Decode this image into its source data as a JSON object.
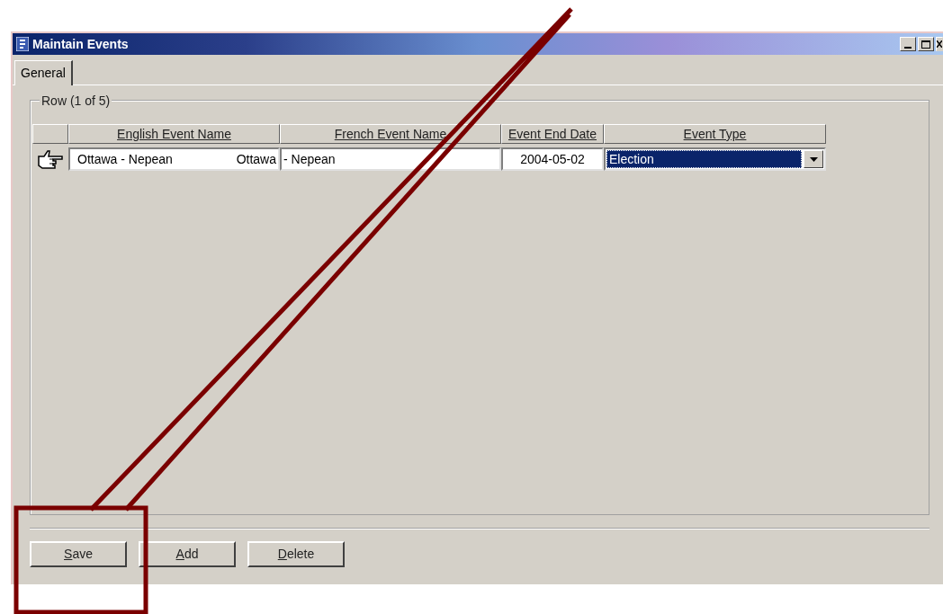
{
  "window": {
    "title": "Maintain Events"
  },
  "tabs": [
    {
      "label": "General",
      "selected": true
    }
  ],
  "group": {
    "label": "Row (1 of 5)"
  },
  "table": {
    "columns": [
      "English Event Name",
      "French Event Name",
      "Event End Date",
      "Event Type"
    ],
    "rows": [
      {
        "current": true,
        "english_name": "Ottawa - Nepean",
        "french_name_overflow": "Ottawa",
        "french_name": "- Nepean",
        "end_date": "2004-05-02",
        "event_type": "Election",
        "type_selected": true
      }
    ]
  },
  "buttons": [
    {
      "label": "Save"
    },
    {
      "label": "Add"
    },
    {
      "label": "Delete"
    }
  ]
}
